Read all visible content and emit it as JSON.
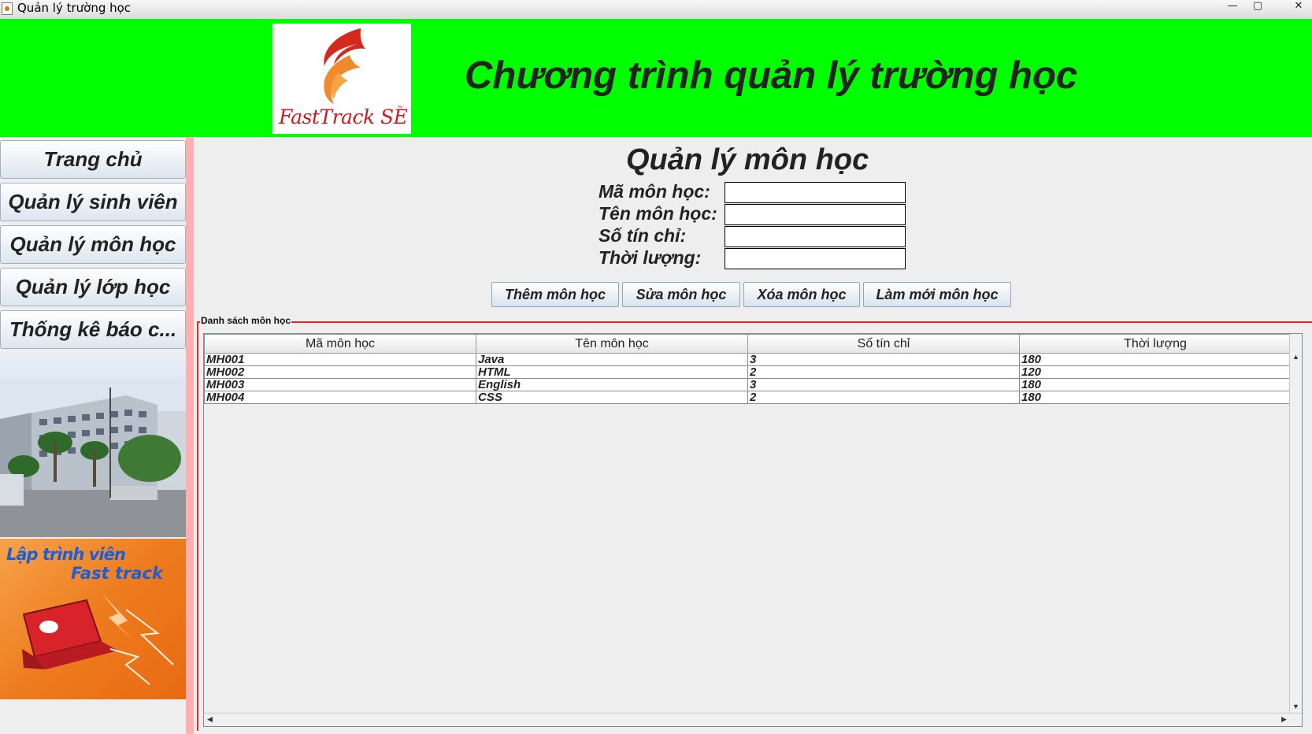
{
  "window": {
    "title": "Quản lý trường học",
    "controls": {
      "minimize": "—",
      "maximize": "▢",
      "close": "✕"
    }
  },
  "header": {
    "logo_text": "FastTrack SE",
    "logo_tm": "™",
    "app_title": "Chương trình quản lý trường học"
  },
  "sidebar": {
    "items": [
      {
        "label": "Trang chủ"
      },
      {
        "label": "Quản lý sinh viên"
      },
      {
        "label": "Quản lý môn học"
      },
      {
        "label": "Quản lý lớp học"
      },
      {
        "label": "Thống kê báo c..."
      }
    ],
    "promo_line1": "Lập trình viên",
    "promo_line2": "Fast track"
  },
  "form": {
    "page_title": "Quản lý môn học",
    "fields": [
      {
        "label": "Mã môn học:",
        "value": ""
      },
      {
        "label": "Tên môn học:",
        "value": ""
      },
      {
        "label": "Số tín chỉ:",
        "value": ""
      },
      {
        "label": "Thời lượng:",
        "value": ""
      }
    ],
    "buttons": {
      "add": "Thêm môn học",
      "edit": "Sửa môn học",
      "delete": "Xóa môn học",
      "refresh": "Làm mới môn học"
    }
  },
  "table": {
    "group_title": "Danh sách môn học",
    "columns": [
      "Mã môn học",
      "Tên môn học",
      "Số tín chỉ",
      "Thời lượng"
    ],
    "rows": [
      [
        "MH001",
        "Java",
        "3",
        "180"
      ],
      [
        "MH002",
        "HTML",
        "2",
        "120"
      ],
      [
        "MH003",
        "English",
        "3",
        "180"
      ],
      [
        "MH004",
        "CSS",
        "2",
        "180"
      ]
    ]
  },
  "colors": {
    "header_bg": "#00ff00",
    "accent_border": "#e32a2a",
    "side_bar": "#ffafaf"
  }
}
